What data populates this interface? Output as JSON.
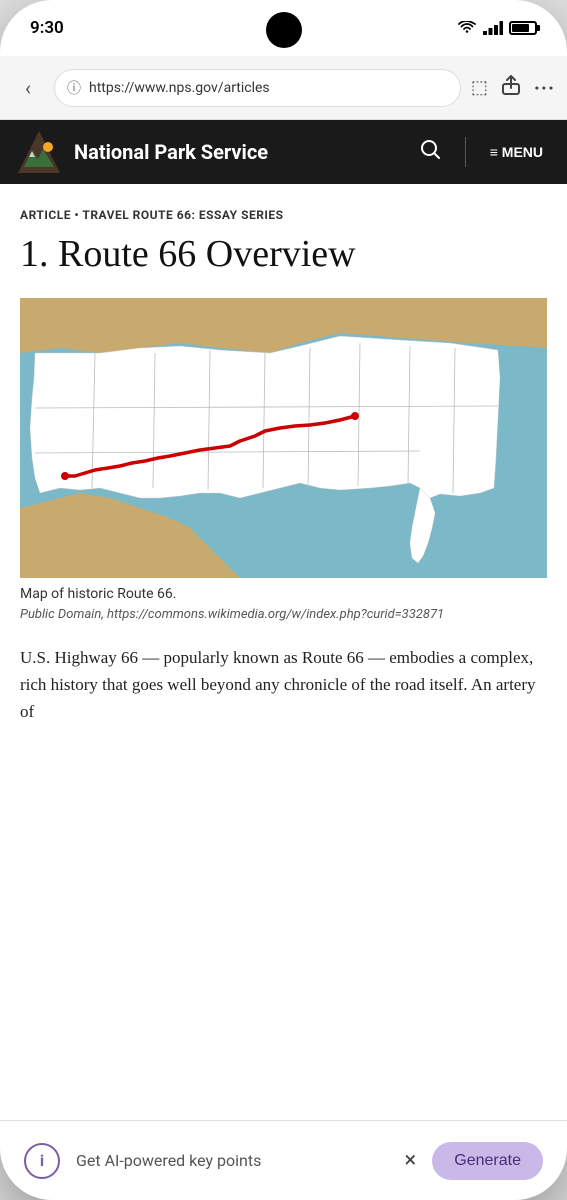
{
  "status": {
    "time": "9:30"
  },
  "browser": {
    "url": "https://www.nps.gov/articles",
    "back_label": "‹",
    "info_icon": "ⓘ",
    "bookmark_icon": "☐",
    "share_icon": "⬆",
    "more_icon": "···"
  },
  "nps_header": {
    "title": "National Park Service",
    "search_icon": "🔍",
    "menu_label": "≡ MENU"
  },
  "article": {
    "category": "ARTICLE • TRAVEL ROUTE 66: ESSAY SERIES",
    "title": "1. Route 66 Overview",
    "map_caption": "Map of historic Route 66.",
    "map_credit": "Public Domain, https://commons.wikimedia.org/w/index.php?curid=332871",
    "body": "U.S. Highway 66 — popularly known as Route 66 — embodies a complex, rich history that goes well beyond any chronicle of the road itself. An artery of"
  },
  "bottom_bar": {
    "info_label": "i",
    "ai_label": "Get AI-powered key points",
    "generate_label": "Generate",
    "close_icon": "×"
  }
}
